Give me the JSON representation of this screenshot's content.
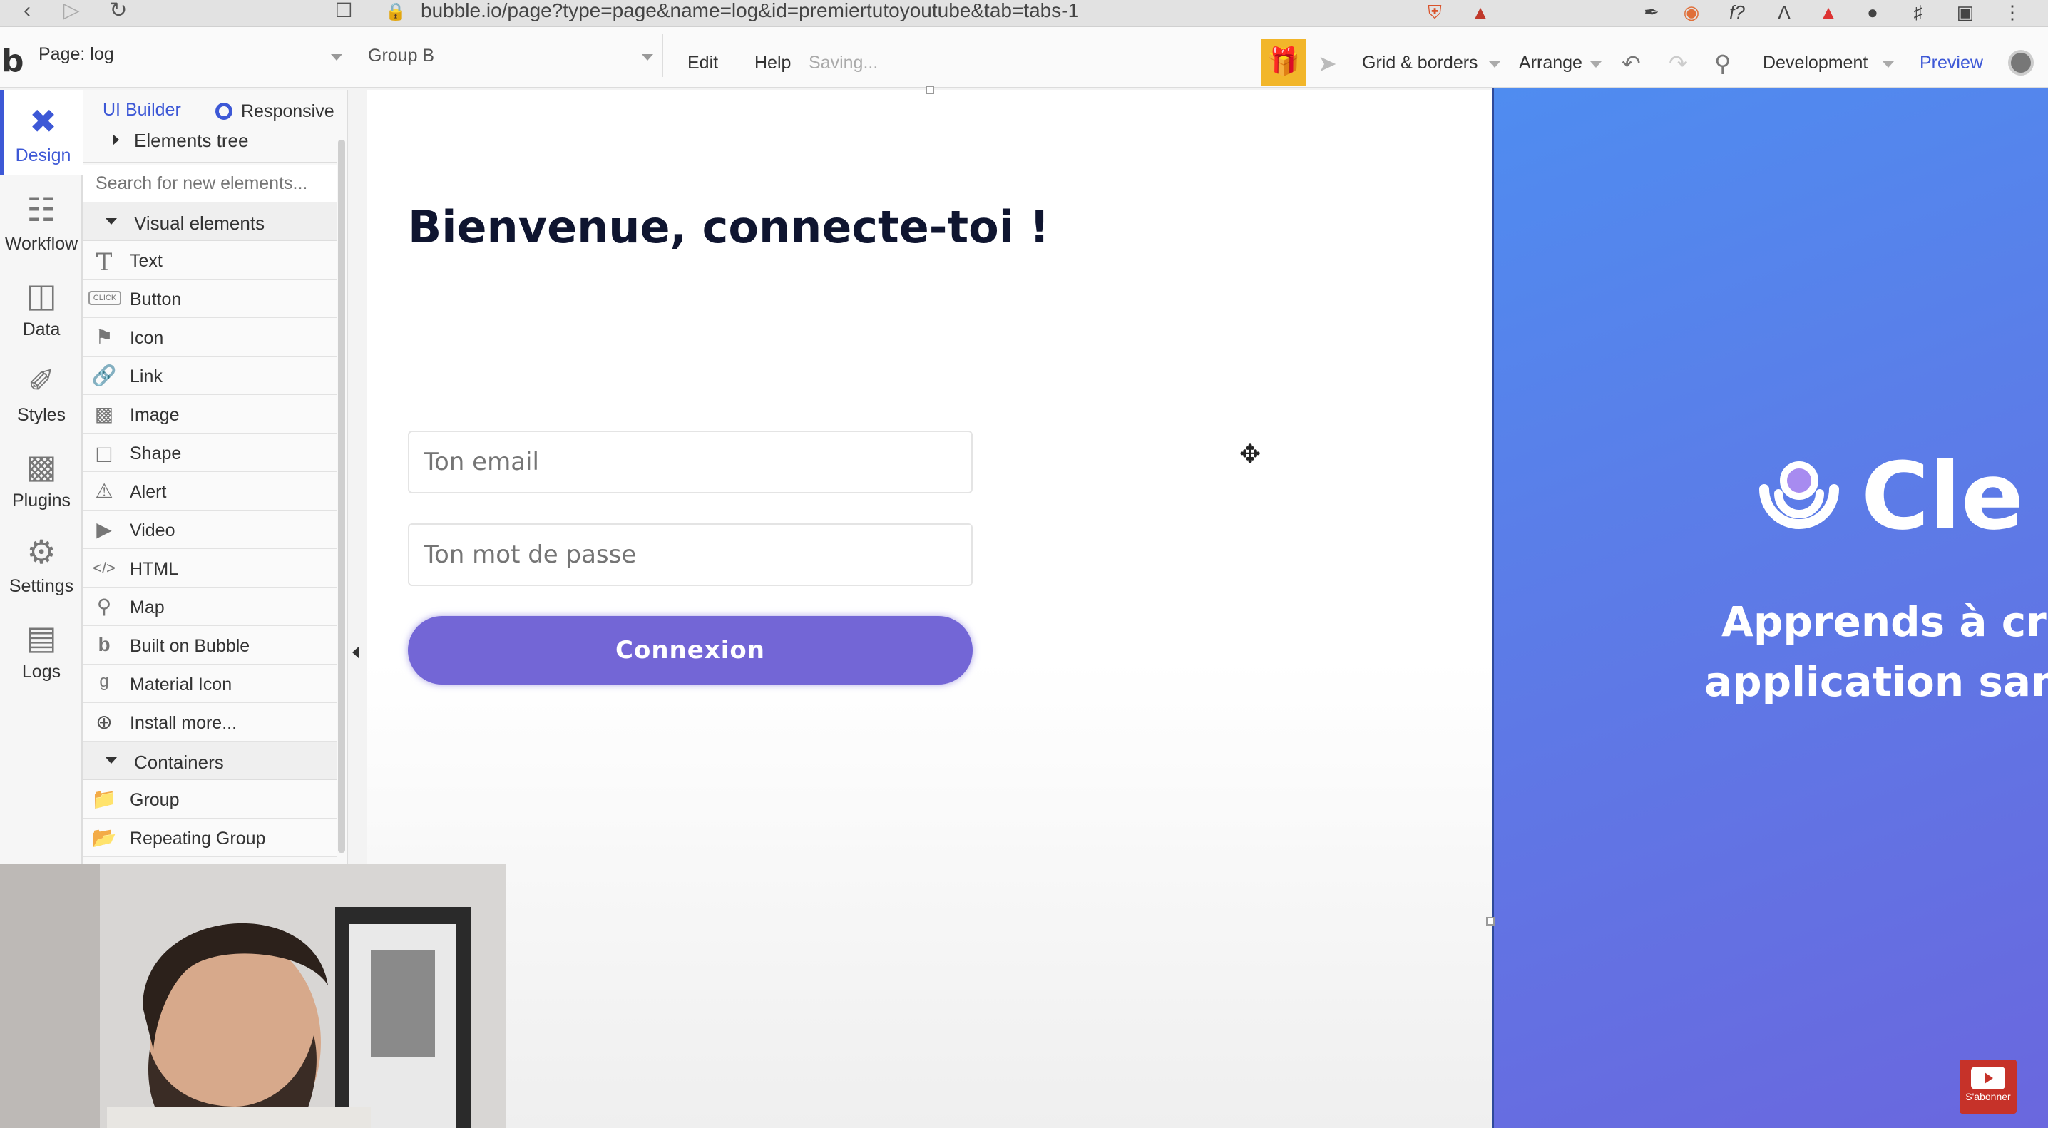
{
  "browser": {
    "url": "bubble.io/page?type=page&name=log&id=premiertutoyoutube&tab=tabs-1"
  },
  "toolbar": {
    "page_label": "Page: log",
    "group_label": "Group B",
    "edit": "Edit",
    "help": "Help",
    "saving": "Saving...",
    "grid": "Grid & borders",
    "arrange": "Arrange",
    "environment": "Development",
    "preview": "Preview"
  },
  "rail": {
    "items": [
      {
        "label": "Design",
        "icon": "design-icon"
      },
      {
        "label": "Workflow",
        "icon": "workflow-icon"
      },
      {
        "label": "Data",
        "icon": "data-icon"
      },
      {
        "label": "Styles",
        "icon": "brush-icon"
      },
      {
        "label": "Plugins",
        "icon": "plugins-icon"
      },
      {
        "label": "Settings",
        "icon": "gear-icon"
      },
      {
        "label": "Logs",
        "icon": "logs-icon"
      }
    ]
  },
  "panel": {
    "tab_ui": "UI Builder",
    "tab_responsive": "Responsive",
    "elements_tree": "Elements tree",
    "search_placeholder": "Search for new elements...",
    "visual_header": "Visual elements",
    "visual_items": [
      {
        "label": "Text",
        "icon": "text-icon"
      },
      {
        "label": "Button",
        "icon": "button-icon"
      },
      {
        "label": "Icon",
        "icon": "flag-icon"
      },
      {
        "label": "Link",
        "icon": "link-icon"
      },
      {
        "label": "Image",
        "icon": "image-icon"
      },
      {
        "label": "Shape",
        "icon": "shape-icon"
      },
      {
        "label": "Alert",
        "icon": "bell-icon"
      },
      {
        "label": "Video",
        "icon": "video-icon"
      },
      {
        "label": "HTML",
        "icon": "code-icon"
      },
      {
        "label": "Map",
        "icon": "pin-icon"
      },
      {
        "label": "Built on Bubble",
        "icon": "bubble-icon"
      },
      {
        "label": "Material Icon",
        "icon": "material-icon"
      },
      {
        "label": "Install more...",
        "icon": "plus-icon"
      }
    ],
    "containers_header": "Containers",
    "container_items": [
      {
        "label": "Group",
        "icon": "folder-icon"
      },
      {
        "label": "Repeating Group",
        "icon": "folders-icon"
      }
    ]
  },
  "canvas": {
    "title": "Bienvenue, connecte-toi !",
    "email_placeholder": "Ton email",
    "password_placeholder": "Ton mot de passe",
    "button": "Connexion"
  },
  "promo": {
    "brand": "Cle",
    "tagline_line1": "Apprends à cré",
    "tagline_line2": "application san"
  },
  "subscribe": {
    "label": "S'abonner"
  },
  "colors": {
    "accent": "#3d58d6",
    "button": "#7366d6",
    "gift": "#f2b62a",
    "subscribe": "#c63229"
  }
}
